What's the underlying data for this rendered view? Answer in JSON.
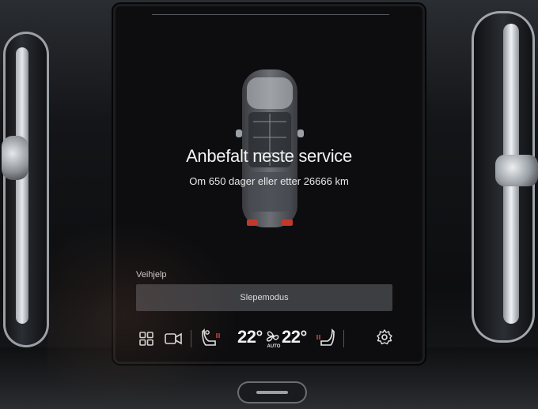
{
  "service": {
    "title": "Anbefalt neste service",
    "detail": "Om 650 dager eller etter 26666 km"
  },
  "roadside": {
    "section_label": "Veihjelp",
    "tow_mode_label": "Slepemodus"
  },
  "climate_bar": {
    "left_temp": "22°",
    "right_temp": "22°",
    "fan_mode": "AUTO",
    "icons": [
      "home-grid-icon",
      "camera-icon",
      "driver-seat-heat-icon",
      "fan-icon",
      "passenger-seat-heat-icon",
      "settings-gear-icon"
    ]
  },
  "colors": {
    "screen_bg": "#0d0d0f",
    "button_bg": "#3d3e42",
    "text": "#f2f2f2",
    "heat_indicator": "#e0483a"
  }
}
